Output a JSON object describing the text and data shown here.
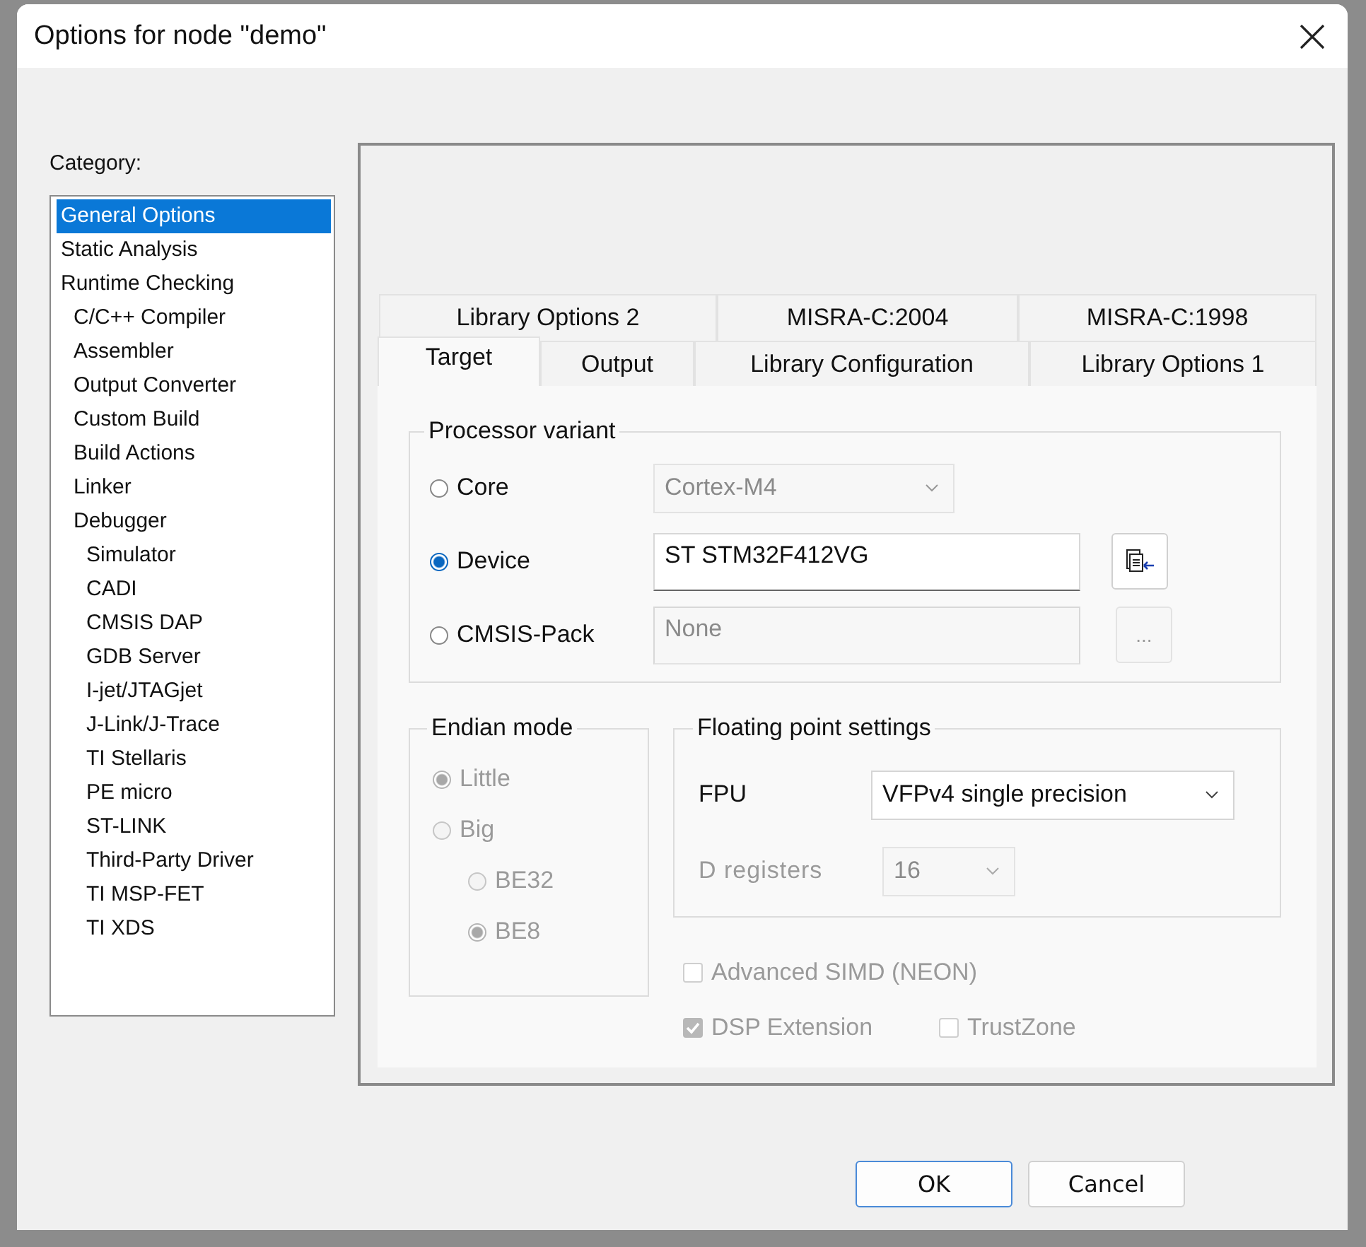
{
  "window": {
    "title": "Options for node \"demo\""
  },
  "category": {
    "label": "Category:",
    "items": [
      {
        "label": "General Options",
        "selected": true
      },
      {
        "label": "Static Analysis",
        "selected": false
      },
      {
        "label": "Runtime Checking",
        "selected": false,
        "children": [
          {
            "label": "C/C++ Compiler",
            "selected": false
          },
          {
            "label": "Assembler",
            "selected": false
          },
          {
            "label": "Output Converter",
            "selected": false
          },
          {
            "label": "Custom Build",
            "selected": false
          },
          {
            "label": "Build Actions",
            "selected": false
          },
          {
            "label": "Linker",
            "selected": false
          },
          {
            "label": "Debugger",
            "selected": false,
            "children": [
              {
                "label": "Simulator",
                "selected": false
              },
              {
                "label": "CADI",
                "selected": false
              },
              {
                "label": "CMSIS DAP",
                "selected": false
              },
              {
                "label": "GDB Server",
                "selected": false
              },
              {
                "label": "I-jet/JTAGjet",
                "selected": false
              },
              {
                "label": "J-Link/J-Trace",
                "selected": false
              },
              {
                "label": "TI Stellaris",
                "selected": false
              },
              {
                "label": "PE micro",
                "selected": false
              },
              {
                "label": "ST-LINK",
                "selected": false
              },
              {
                "label": "Third-Party Driver",
                "selected": false
              },
              {
                "label": "TI MSP-FET",
                "selected": false
              },
              {
                "label": "TI XDS",
                "selected": false
              }
            ]
          }
        ]
      }
    ]
  },
  "tabs": [
    [
      {
        "label": "Library Options 2",
        "selected": false
      },
      {
        "label": "MISRA-C:2004",
        "selected": false
      },
      {
        "label": "MISRA-C:1998",
        "selected": false
      }
    ],
    [
      {
        "label": "Target",
        "selected": true
      },
      {
        "label": "Output",
        "selected": false
      },
      {
        "label": "Library Configuration",
        "selected": false
      },
      {
        "label": "Library Options 1",
        "selected": false
      }
    ]
  ],
  "processor_variant": {
    "title": "Processor variant",
    "options": [
      {
        "label": "Core",
        "selected": false,
        "field": {
          "kind": "combo",
          "value": "Cortex-M4",
          "disabled": true
        }
      },
      {
        "label": "Device",
        "selected": true,
        "field": {
          "kind": "text",
          "value": "ST STM32F412VG",
          "disabled": false
        },
        "button": {
          "kind": "icon",
          "disabled": false
        }
      },
      {
        "label": "CMSIS-Pack",
        "selected": false,
        "field": {
          "kind": "text",
          "value": "None",
          "disabled": true
        },
        "button": {
          "kind": "text",
          "label": "...",
          "disabled": true
        }
      }
    ]
  },
  "endian_mode": {
    "title": "Endian mode",
    "options": [
      {
        "label": "Little",
        "selected": true,
        "disabled": true
      },
      {
        "label": "Big",
        "selected": false,
        "disabled": true,
        "children": [
          {
            "label": "BE32",
            "selected": false,
            "disabled": true
          },
          {
            "label": "BE8",
            "selected": true,
            "disabled": true
          }
        ]
      }
    ]
  },
  "floating_point": {
    "title": "Floating point settings",
    "rows": [
      {
        "label": "FPU",
        "value": "VFPv4 single precision",
        "disabled": false
      },
      {
        "label": "D registers",
        "value": "16",
        "disabled": true
      }
    ]
  },
  "checkboxes": [
    [
      {
        "label": "Advanced SIMD (NEON)",
        "checked": false,
        "disabled": true
      }
    ],
    [
      {
        "label": "DSP Extension",
        "checked": true,
        "disabled": true
      },
      {
        "label": "TrustZone",
        "checked": false,
        "disabled": true
      }
    ]
  ],
  "buttons": [
    {
      "label": "OK",
      "default": true
    },
    {
      "label": "Cancel",
      "default": false
    }
  ]
}
